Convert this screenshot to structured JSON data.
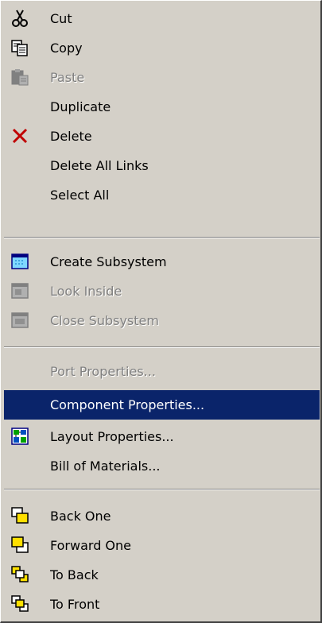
{
  "menu": {
    "items": [
      {
        "label": "Cut",
        "icon": "scissors-icon"
      },
      {
        "label": "Copy",
        "icon": "copy-icon"
      },
      {
        "label": "Paste",
        "icon": "paste-icon",
        "disabled": true
      },
      {
        "label": "Duplicate"
      },
      {
        "label": "Delete",
        "icon": "delete-x-icon"
      },
      {
        "label": "Delete All Links"
      },
      {
        "label": "Select All"
      },
      {
        "label": "Create Subsystem",
        "icon": "subsystem-icon"
      },
      {
        "label": "Look Inside",
        "icon": "look-inside-icon",
        "disabled": true
      },
      {
        "label": "Close Subsystem",
        "icon": "close-subsystem-icon",
        "disabled": true
      },
      {
        "label": "Port Properties...",
        "disabled": true
      },
      {
        "label": "Component Properties...",
        "selected": true
      },
      {
        "label": "Layout Properties...",
        "icon": "layout-icon"
      },
      {
        "label": "Bill of Materials..."
      },
      {
        "label": "Back One",
        "icon": "back-one-icon"
      },
      {
        "label": "Forward One",
        "icon": "forward-one-icon"
      },
      {
        "label": "To Back",
        "icon": "to-back-icon"
      },
      {
        "label": "To Front",
        "icon": "to-front-icon"
      }
    ]
  },
  "colors": {
    "menu_bg": "#d4d0c8",
    "highlight": "#0a246a",
    "disabled_text": "#808080"
  }
}
